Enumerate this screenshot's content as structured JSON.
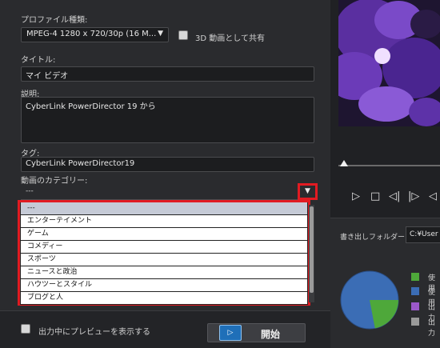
{
  "profile": {
    "label": "プロファイル種類:",
    "value": "MPEG-4 1280 x 720/30p (16 M...",
    "share_3d_label": "3D 動画として共有"
  },
  "title_field": {
    "label": "タイトル:",
    "value": "マイ ビデオ"
  },
  "description": {
    "label": "説明:",
    "value": "CyberLink PowerDirector 19 から"
  },
  "tags": {
    "label": "タグ:",
    "value": "CyberLink PowerDirector19"
  },
  "category": {
    "label": "動画のカテゴリー:",
    "selected": "---",
    "options": [
      "---",
      "エンターテイメント",
      "ゲーム",
      "コメディー",
      "スポーツ",
      "ニュースと政治",
      "ハウツーとスタイル",
      "ブログと人"
    ]
  },
  "bottom": {
    "preview_label": "出力中にプレビューを表示する",
    "start_label": "開始"
  },
  "output": {
    "folder_label": "書き出しフォルダー:",
    "folder_value": "C:¥User",
    "legend": [
      {
        "text": "使用",
        "color": "#4ea83a"
      },
      {
        "text": "使用",
        "color": "#3b6db5"
      },
      {
        "text": "出力",
        "color": "#9b59c9"
      },
      {
        "text": "出力",
        "color": "#9a9a9a"
      }
    ],
    "disk_usage": {
      "used_fraction": 0.22
    }
  },
  "colors": {
    "highlight_red": "#e11b22",
    "pie_blue": "#3b6db5",
    "pie_green": "#4ea83a"
  }
}
